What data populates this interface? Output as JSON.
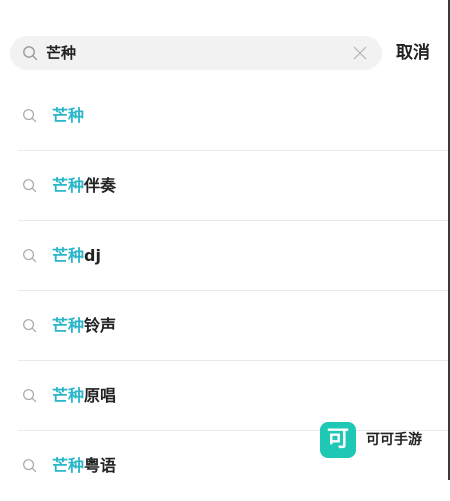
{
  "search": {
    "query": "芒种",
    "cancel_label": "取消"
  },
  "suggestions": [
    {
      "highlight": "芒种",
      "rest": ""
    },
    {
      "highlight": "芒种",
      "rest": "伴奏"
    },
    {
      "highlight": "芒种",
      "rest": "dj"
    },
    {
      "highlight": "芒种",
      "rest": "铃声"
    },
    {
      "highlight": "芒种",
      "rest": "原唱"
    },
    {
      "highlight": "芒种",
      "rest": "粤语"
    }
  ],
  "watermark": {
    "logo_char": "可",
    "name": "可可手游"
  },
  "colors": {
    "highlight": "#2ab6c9",
    "search_bg": "#f2f2f2",
    "watermark_logo": "#1ec8b5"
  },
  "icons": {
    "search": "search-icon",
    "clear": "close-icon"
  }
}
